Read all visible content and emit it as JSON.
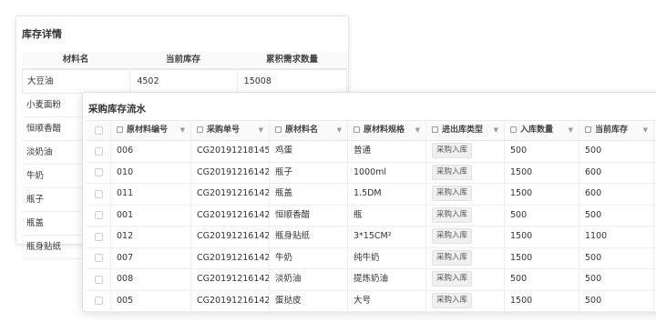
{
  "stock_detail": {
    "title": "库存详情",
    "headers": [
      "材料名",
      "当前库存",
      "累积需求数量"
    ],
    "first_row": [
      "大豆油",
      "4502",
      "15008"
    ],
    "items": [
      "小麦面粉",
      "恒顺香醋",
      "淡奶油",
      "牛奶",
      "瓶子",
      "瓶盖",
      "瓶身贴纸"
    ]
  },
  "flow": {
    "title": "采购库存流水",
    "headers": [
      "原材料编号",
      "采购单号",
      "原材料名",
      "原材料规格",
      "进出库类型",
      "入库数量",
      "当前库存"
    ],
    "rows": [
      {
        "id": "006",
        "order": "CG20191218145",
        "name": "鸡蛋",
        "spec": "普通",
        "type": "采购入库",
        "qty": "500",
        "stock": "500"
      },
      {
        "id": "010",
        "order": "CG20191216142",
        "name": "瓶子",
        "spec": "1000ml",
        "type": "采购入库",
        "qty": "1500",
        "stock": "600"
      },
      {
        "id": "011",
        "order": "CG20191216142",
        "name": "瓶盖",
        "spec": "1.5DM",
        "type": "采购入库",
        "qty": "1500",
        "stock": "600"
      },
      {
        "id": "001",
        "order": "CG20191216142",
        "name": "恒顺香醋",
        "spec": "瓶",
        "type": "采购入库",
        "qty": "500",
        "stock": "500"
      },
      {
        "id": "012",
        "order": "CG20191216142",
        "name": "瓶身贴纸",
        "spec": "3*15CM²",
        "type": "采购入库",
        "qty": "1500",
        "stock": "1100"
      },
      {
        "id": "007",
        "order": "CG20191216142",
        "name": "牛奶",
        "spec": "纯牛奶",
        "type": "采购入库",
        "qty": "1500",
        "stock": "500"
      },
      {
        "id": "008",
        "order": "CG20191216142",
        "name": "淡奶油",
        "spec": "提炼奶油",
        "type": "采购入库",
        "qty": "500",
        "stock": "500"
      },
      {
        "id": "005",
        "order": "CG20191216142",
        "name": "蛋挞皮",
        "spec": "大号",
        "type": "采购入库",
        "qty": "1500",
        "stock": "500"
      }
    ]
  },
  "icons": {
    "column_icon": "table-column-icon",
    "sort_caret": "caret-down-icon"
  }
}
